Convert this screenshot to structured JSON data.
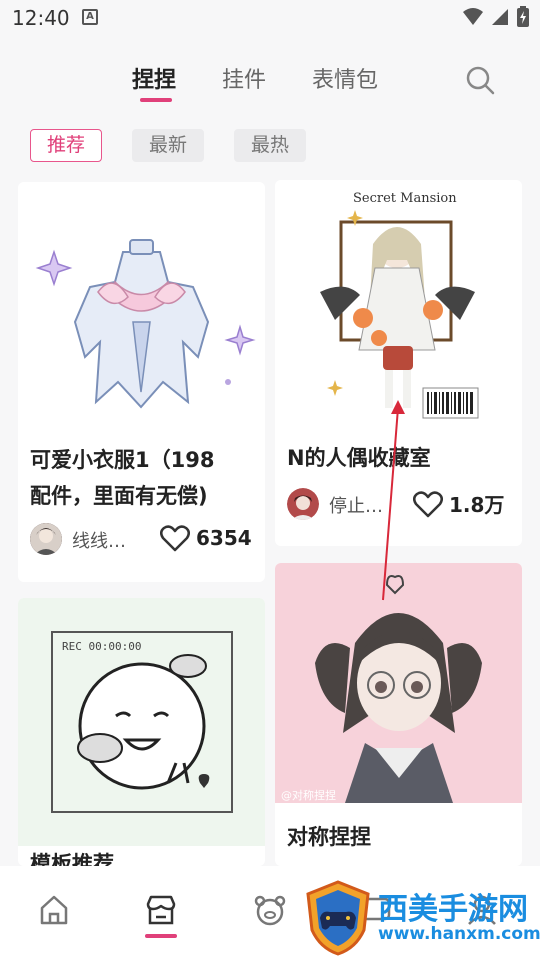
{
  "status": {
    "time": "12:40",
    "notif": "A"
  },
  "tabs": [
    "捏捏",
    "挂件",
    "表情包"
  ],
  "filters": [
    "推荐",
    "最新",
    "最热"
  ],
  "cards": [
    {
      "title_line1": "可爱小衣服1（198",
      "title_line2": "配件，里面有无偿)",
      "author": "线线…",
      "likes": "6354"
    },
    {
      "title_line1": "N的人偶收藏室",
      "author": "停止…",
      "likes": "1.8万",
      "image_text": "Secret Mansion"
    },
    {
      "title_line1": "模板推荐",
      "image_text": "REC 00:00:00"
    },
    {
      "title_line1": "对称捏捏",
      "image_text": "@对称捏捏"
    }
  ],
  "watermark": {
    "name": "西美手游网",
    "url": "www.hanxm.com"
  },
  "colors": {
    "accent": "#e0407a",
    "chip_bg": "#ebebed",
    "page_bg": "#f7f7f8"
  }
}
